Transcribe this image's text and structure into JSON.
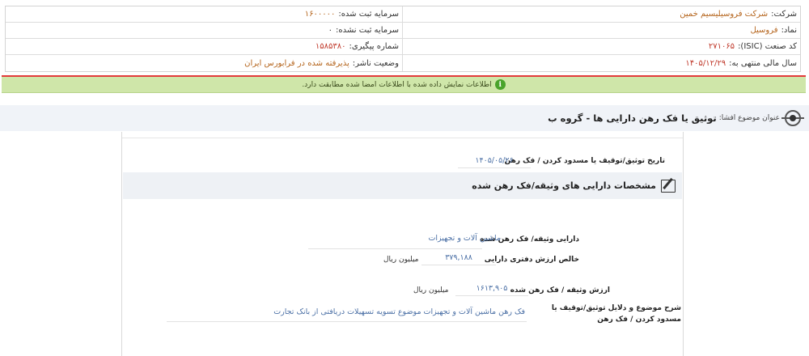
{
  "company_info": {
    "company_label": "شرکت:",
    "company_value": "شرکت فروسیلیسیم خمین",
    "registered_capital_label": "سرمایه ثبت شده:",
    "registered_capital_value": "۱۶۰۰۰۰۰",
    "symbol_label": "نماد:",
    "symbol_value": "فروسیل",
    "unregistered_capital_label": "سرمایه ثبت نشده:",
    "unregistered_capital_value": "۰",
    "isic_label": "کد صنعت (ISIC):",
    "isic_value": "۲۷۱۰۶۵",
    "tracking_label": "شماره پیگیری:",
    "tracking_value": "۱۵۸۵۳۸۰",
    "fiscal_year_label": "سال مالی منتهی به:",
    "fiscal_year_value": "۱۴۰۵/۱۲/۲۹",
    "publisher_status_label": "وضعیت ناشر:",
    "publisher_status_value": "پذیرفته شده در فرابورس ایران"
  },
  "notice": {
    "text": "اطلاعات نمایش داده شده با اطلاعات امضا شده مطابقت دارد."
  },
  "subject": {
    "label": "عنوان موضوع افشا:",
    "title": "توثیق یا فک رهن دارایی ها - گروه ب"
  },
  "details": {
    "date_label": "تاریخ توثیق/توقیف یا مسدود کردن / فک رهن",
    "date_value": "۱۴۰۵/۰۵/۲۶",
    "section_title": "مشخصات دارایی های وثیقه/فک رهن شده",
    "asset_label": "دارایی وثیقه/ فک رهن شده",
    "asset_value": "ماشین آلات و تجهیزات",
    "book_value_label": "خالص ارزش دفتری دارایی",
    "book_value_value": "۳۷۹,۱۸۸",
    "book_value_unit": "میلیون ریال",
    "collateral_value_label": "ارزش وثیقه / فک رهن شده",
    "collateral_value_value": "۱۶۱۳,۹۰۵",
    "collateral_value_unit": "میلیون ریال",
    "description_label": "شرح موضوع و دلایل توثیق/توقیف یا مسدود کردن / فک رهن",
    "description_value": "فک رهن ماشین آلات و تجهیزات موضوع تسویه تسهیلات دریافتی از بانک تجارت"
  }
}
